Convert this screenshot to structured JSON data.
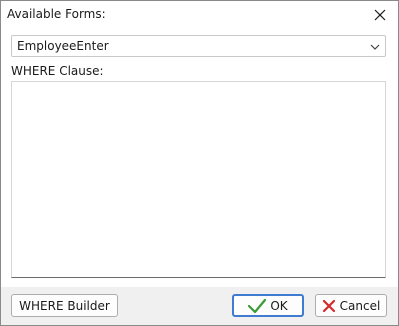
{
  "window": {
    "title": "Available Forms:"
  },
  "form_select": {
    "value": "EmployeeEnter"
  },
  "where": {
    "label": "WHERE Clause:",
    "value": ""
  },
  "buttons": {
    "where_builder": "WHERE Builder",
    "ok": "OK",
    "cancel": "Cancel"
  },
  "icons": {
    "close": "close-icon",
    "chevron": "chevron-down-icon",
    "ok": "checkmark-icon",
    "cancel": "x-icon"
  },
  "colors": {
    "ok_check": "#3a9a35",
    "cancel_x": "#d42a2a",
    "default_button_border": "#3f7bd1"
  }
}
